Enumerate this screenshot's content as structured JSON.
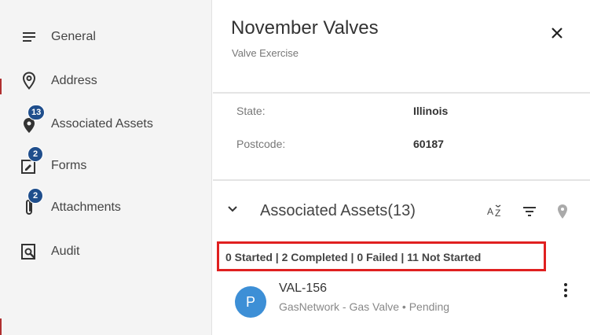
{
  "sidebar": {
    "items": [
      {
        "label": "General",
        "icon": "list-icon"
      },
      {
        "label": "Address",
        "icon": "location-pin-outline-icon"
      },
      {
        "label": "Associated Assets",
        "icon": "location-pin-icon",
        "badge": "13"
      },
      {
        "label": "Forms",
        "icon": "form-icon",
        "badge": "2"
      },
      {
        "label": "Attachments",
        "icon": "paperclip-icon",
        "badge": "2"
      },
      {
        "label": "Audit",
        "icon": "audit-search-icon"
      }
    ]
  },
  "header": {
    "title": "November Valves",
    "subtitle": "Valve Exercise"
  },
  "address": {
    "state_label": "State:",
    "state_value": "Illinois",
    "postcode_label": "Postcode:",
    "postcode_value": "60187"
  },
  "assets_section": {
    "title": "Associated Assets",
    "count": "(13)",
    "summary": "0 Started | 2 Completed | 0 Failed | 11 Not Started"
  },
  "asset": {
    "avatar_letter": "P",
    "id": "VAL-156",
    "description": "GasNetwork - Gas Valve • Pending"
  },
  "colors": {
    "badge": "#1f4e8c",
    "avatar": "#3d8fd6",
    "highlight": "#e02020"
  }
}
